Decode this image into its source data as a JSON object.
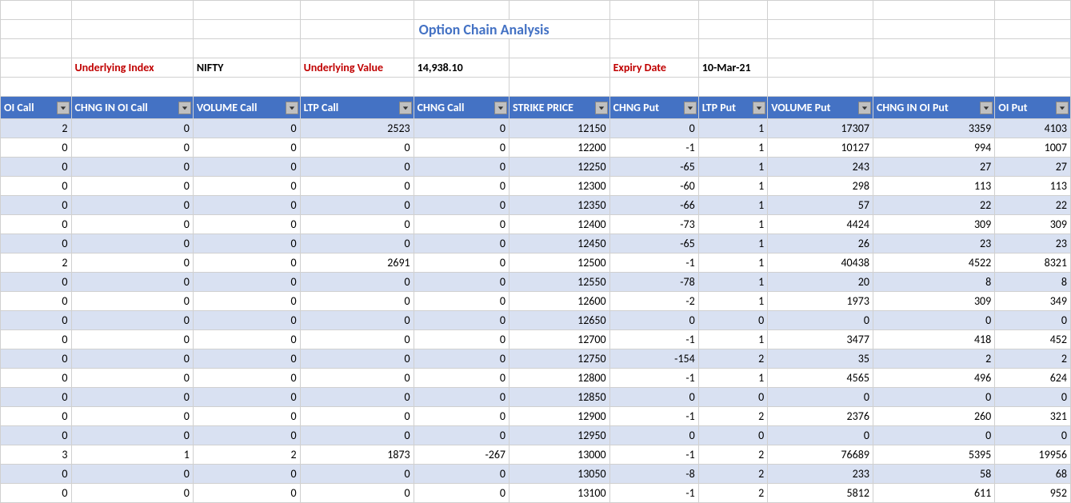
{
  "title": "Option Chain Analysis",
  "meta": {
    "underlying_index_label": "Underlying Index",
    "underlying_index_value": "NIFTY",
    "underlying_value_label": "Underlying Value",
    "underlying_value": "14,938.10",
    "expiry_label": "Expiry Date",
    "expiry_value": "10-Mar-21"
  },
  "headers": {
    "c1": "OI Call",
    "c2": "CHNG IN OI Call",
    "c3": "VOLUME Call",
    "c4": "LTP Call",
    "c5": "CHNG Call",
    "c6": "STRIKE PRICE",
    "c7": "CHNG Put",
    "c8": "LTP Put",
    "c9": "VOLUME Put",
    "c10": "CHNG IN OI Put",
    "c11": "OI Put"
  },
  "rows": [
    {
      "oi_call": 2,
      "chng_oi_call": 0,
      "vol_call": 0,
      "ltp_call": 2523,
      "chng_call": 0,
      "strike": 12150,
      "chng_put": 0,
      "ltp_put": 1,
      "vol_put": 17307,
      "chng_oi_put": 3359,
      "oi_put": 4103
    },
    {
      "oi_call": 0,
      "chng_oi_call": 0,
      "vol_call": 0,
      "ltp_call": 0,
      "chng_call": 0,
      "strike": 12200,
      "chng_put": -1,
      "ltp_put": 1,
      "vol_put": 10127,
      "chng_oi_put": 994,
      "oi_put": 1007
    },
    {
      "oi_call": 0,
      "chng_oi_call": 0,
      "vol_call": 0,
      "ltp_call": 0,
      "chng_call": 0,
      "strike": 12250,
      "chng_put": -65,
      "ltp_put": 1,
      "vol_put": 243,
      "chng_oi_put": 27,
      "oi_put": 27
    },
    {
      "oi_call": 0,
      "chng_oi_call": 0,
      "vol_call": 0,
      "ltp_call": 0,
      "chng_call": 0,
      "strike": 12300,
      "chng_put": -60,
      "ltp_put": 1,
      "vol_put": 298,
      "chng_oi_put": 113,
      "oi_put": 113
    },
    {
      "oi_call": 0,
      "chng_oi_call": 0,
      "vol_call": 0,
      "ltp_call": 0,
      "chng_call": 0,
      "strike": 12350,
      "chng_put": -66,
      "ltp_put": 1,
      "vol_put": 57,
      "chng_oi_put": 22,
      "oi_put": 22
    },
    {
      "oi_call": 0,
      "chng_oi_call": 0,
      "vol_call": 0,
      "ltp_call": 0,
      "chng_call": 0,
      "strike": 12400,
      "chng_put": -73,
      "ltp_put": 1,
      "vol_put": 4424,
      "chng_oi_put": 309,
      "oi_put": 309
    },
    {
      "oi_call": 0,
      "chng_oi_call": 0,
      "vol_call": 0,
      "ltp_call": 0,
      "chng_call": 0,
      "strike": 12450,
      "chng_put": -65,
      "ltp_put": 1,
      "vol_put": 26,
      "chng_oi_put": 23,
      "oi_put": 23
    },
    {
      "oi_call": 2,
      "chng_oi_call": 0,
      "vol_call": 0,
      "ltp_call": 2691,
      "chng_call": 0,
      "strike": 12500,
      "chng_put": -1,
      "ltp_put": 1,
      "vol_put": 40438,
      "chng_oi_put": 4522,
      "oi_put": 8321
    },
    {
      "oi_call": 0,
      "chng_oi_call": 0,
      "vol_call": 0,
      "ltp_call": 0,
      "chng_call": 0,
      "strike": 12550,
      "chng_put": -78,
      "ltp_put": 1,
      "vol_put": 20,
      "chng_oi_put": 8,
      "oi_put": 8
    },
    {
      "oi_call": 0,
      "chng_oi_call": 0,
      "vol_call": 0,
      "ltp_call": 0,
      "chng_call": 0,
      "strike": 12600,
      "chng_put": -2,
      "ltp_put": 1,
      "vol_put": 1973,
      "chng_oi_put": 309,
      "oi_put": 349
    },
    {
      "oi_call": 0,
      "chng_oi_call": 0,
      "vol_call": 0,
      "ltp_call": 0,
      "chng_call": 0,
      "strike": 12650,
      "chng_put": 0,
      "ltp_put": 0,
      "vol_put": 0,
      "chng_oi_put": 0,
      "oi_put": 0
    },
    {
      "oi_call": 0,
      "chng_oi_call": 0,
      "vol_call": 0,
      "ltp_call": 0,
      "chng_call": 0,
      "strike": 12700,
      "chng_put": -1,
      "ltp_put": 1,
      "vol_put": 3477,
      "chng_oi_put": 418,
      "oi_put": 452
    },
    {
      "oi_call": 0,
      "chng_oi_call": 0,
      "vol_call": 0,
      "ltp_call": 0,
      "chng_call": 0,
      "strike": 12750,
      "chng_put": -154,
      "ltp_put": 2,
      "vol_put": 35,
      "chng_oi_put": 2,
      "oi_put": 2
    },
    {
      "oi_call": 0,
      "chng_oi_call": 0,
      "vol_call": 0,
      "ltp_call": 0,
      "chng_call": 0,
      "strike": 12800,
      "chng_put": -1,
      "ltp_put": 1,
      "vol_put": 4565,
      "chng_oi_put": 496,
      "oi_put": 624
    },
    {
      "oi_call": 0,
      "chng_oi_call": 0,
      "vol_call": 0,
      "ltp_call": 0,
      "chng_call": 0,
      "strike": 12850,
      "chng_put": 0,
      "ltp_put": 0,
      "vol_put": 0,
      "chng_oi_put": 0,
      "oi_put": 0
    },
    {
      "oi_call": 0,
      "chng_oi_call": 0,
      "vol_call": 0,
      "ltp_call": 0,
      "chng_call": 0,
      "strike": 12900,
      "chng_put": -1,
      "ltp_put": 2,
      "vol_put": 2376,
      "chng_oi_put": 260,
      "oi_put": 321
    },
    {
      "oi_call": 0,
      "chng_oi_call": 0,
      "vol_call": 0,
      "ltp_call": 0,
      "chng_call": 0,
      "strike": 12950,
      "chng_put": 0,
      "ltp_put": 0,
      "vol_put": 0,
      "chng_oi_put": 0,
      "oi_put": 0
    },
    {
      "oi_call": 3,
      "chng_oi_call": 1,
      "vol_call": 2,
      "ltp_call": 1873,
      "chng_call": -267,
      "strike": 13000,
      "chng_put": -1,
      "ltp_put": 2,
      "vol_put": 76689,
      "chng_oi_put": 5395,
      "oi_put": 19956
    },
    {
      "oi_call": 0,
      "chng_oi_call": 0,
      "vol_call": 0,
      "ltp_call": 0,
      "chng_call": 0,
      "strike": 13050,
      "chng_put": -8,
      "ltp_put": 2,
      "vol_put": 233,
      "chng_oi_put": 58,
      "oi_put": 68
    },
    {
      "oi_call": 0,
      "chng_oi_call": 0,
      "vol_call": 0,
      "ltp_call": 0,
      "chng_call": 0,
      "strike": 13100,
      "chng_put": -1,
      "ltp_put": 2,
      "vol_put": 5812,
      "chng_oi_put": 611,
      "oi_put": 952
    }
  ]
}
